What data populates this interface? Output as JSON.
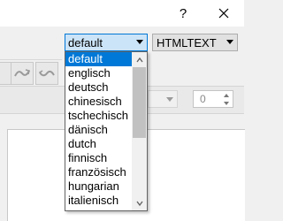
{
  "titlebar": {
    "help_label": "?"
  },
  "toolbar": {
    "language_combo_value": "default",
    "format_combo_value": "HTMLTEXT"
  },
  "spinner": {
    "value": "0"
  },
  "dropdown": {
    "options": [
      "default",
      "englisch",
      "deutsch",
      "chinesisch",
      "tschechisch",
      "dänisch",
      "dutch",
      "finnisch",
      "französisch",
      "hungarian",
      "italienisch"
    ],
    "selected_index": 0
  },
  "colors": {
    "selection": "#0078d7",
    "focus_border": "#0078d7",
    "focus_fill": "#cce4f7"
  }
}
